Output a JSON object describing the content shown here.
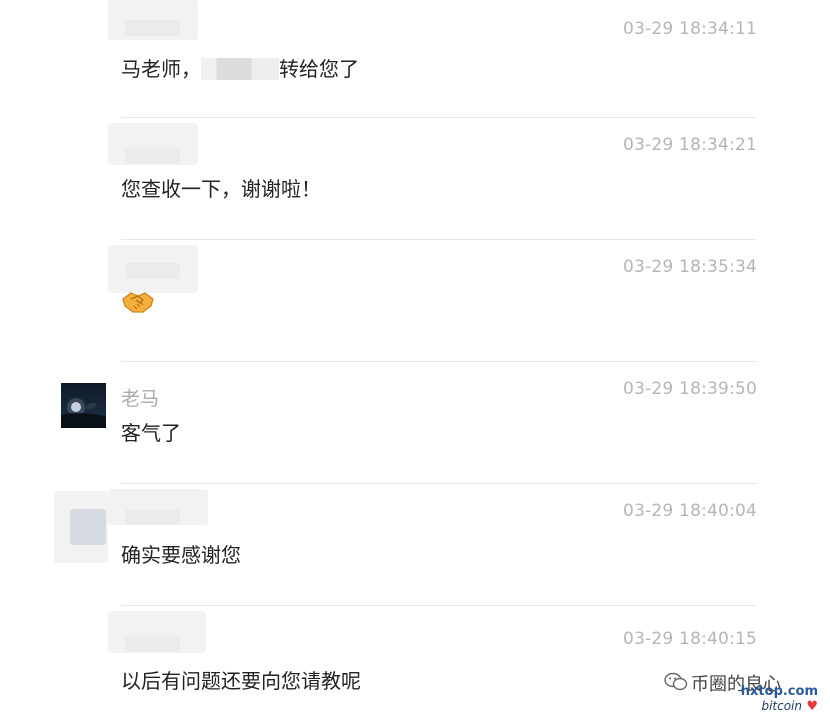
{
  "messages": [
    {
      "time": "03-29 18:34:11",
      "sender": "",
      "text_before": "马老师，",
      "text_after": "转给您了"
    },
    {
      "time": "03-29 18:34:21",
      "sender": "",
      "text": "您查收一下，谢谢啦！"
    },
    {
      "time": "03-29 18:35:34",
      "sender": "",
      "emoji": "handshake-emoji"
    },
    {
      "time": "03-29 18:39:50",
      "sender": "老马",
      "text": "客气了"
    },
    {
      "time": "03-29 18:40:04",
      "sender": "",
      "text": "确实要感谢您"
    },
    {
      "time": "03-29 18:40:15",
      "sender": "",
      "text": "以后有问题还要向您请教呢"
    }
  ],
  "watermark": {
    "name": "币圈的良心",
    "url": "hxtop.com",
    "tag": "bitcoin",
    "icon": "wechat-logo-icon"
  },
  "colors": {
    "time": "#b5b5b5",
    "sender": "#ababab",
    "text": "#222222",
    "separator": "#e7e7e7"
  }
}
